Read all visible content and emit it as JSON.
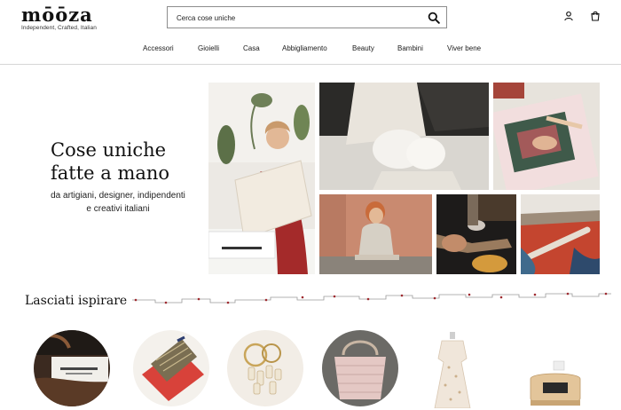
{
  "brand": {
    "name": "mōōza",
    "tagline": "Independent, Crafted, Italian"
  },
  "search": {
    "placeholder": "Cerca cose uniche"
  },
  "header_icons": [
    "search-icon",
    "user-icon",
    "shopping-bag-icon"
  ],
  "nav": {
    "items": [
      {
        "label": "Accessori"
      },
      {
        "label": "Gioielli"
      },
      {
        "label": "Casa"
      },
      {
        "label": "Abbigliamento"
      },
      {
        "label": "Beauty"
      },
      {
        "label": "Bambini"
      },
      {
        "label": "Viver bene"
      }
    ]
  },
  "hero": {
    "title_line1": "Cose uniche",
    "title_line2": "fatte a mano",
    "subtitle_line1": "da artigiani, designer, indipendenti",
    "subtitle_line2": "e creativi italiani"
  },
  "inspire": {
    "title": "Lasciati ispirare"
  },
  "colors": {
    "accent_red": "#9e2a2f",
    "divider": "#d6d6d6",
    "text": "#1a1a1a"
  }
}
